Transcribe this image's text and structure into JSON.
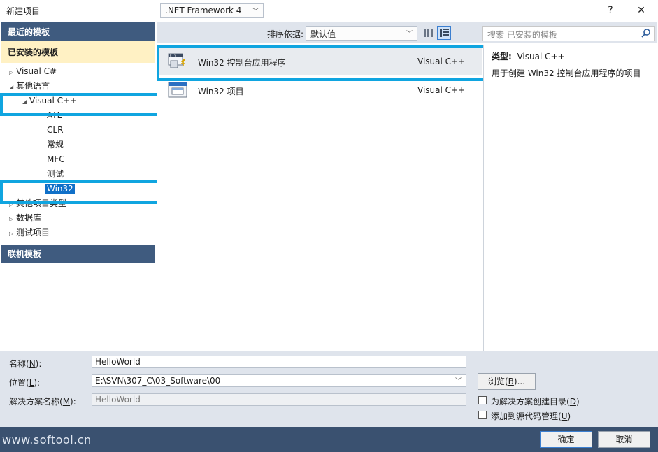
{
  "window": {
    "title": "新建项目",
    "help": "?",
    "close": "✕"
  },
  "left": {
    "recent_header": "最近的模板",
    "installed_header": "已安装的模板",
    "online_header": "联机模板",
    "tree": {
      "visual_csharp": "Visual C#",
      "other_languages": "其他语言",
      "visual_cpp": "Visual C++",
      "atl": "ATL",
      "clr": "CLR",
      "general": "常规",
      "mfc": "MFC",
      "test": "测试",
      "win32": "Win32",
      "other_project_types": "其他项目类型",
      "database": "数据库",
      "test_projects": "测试项目"
    }
  },
  "toolbar": {
    "framework": ".NET Framework 4",
    "sort_label": "排序依据:",
    "sort_value": "默认值",
    "search_placeholder": "搜索 已安装的模板"
  },
  "templates": [
    {
      "name": "Win32 控制台应用程序",
      "lang": "Visual C++",
      "icon": "console-app-icon"
    },
    {
      "name": "Win32 项目",
      "lang": "Visual C++",
      "icon": "window-project-icon"
    }
  ],
  "details": {
    "type_label": "类型:",
    "type_value": "Visual C++",
    "description": "用于创建 Win32 控制台应用程序的项目"
  },
  "form": {
    "name_label_pre": "名称(",
    "name_label_key": "N",
    "name_label_post": "):",
    "name_value": "HelloWorld",
    "location_label_pre": "位置(",
    "location_label_key": "L",
    "location_label_post": "):",
    "location_value": "E:\\SVN\\307_C\\03_Software\\00",
    "solution_label_pre": "解决方案名称(",
    "solution_label_key": "M",
    "solution_label_post": "):",
    "solution_value": "HelloWorld",
    "browse_pre": "浏览(",
    "browse_key": "B",
    "browse_post": ")...",
    "create_dir_pre": "为解决方案创建目录(",
    "create_dir_key": "D",
    "create_dir_post": ")",
    "source_control_pre": "添加到源代码管理(",
    "source_control_key": "U",
    "source_control_post": ")"
  },
  "buttons": {
    "ok": "确定",
    "cancel": "取消"
  },
  "watermark": "www.softool.cn",
  "colors": {
    "highlight_border": "#10a5e0",
    "header_bg": "#3f5b7f",
    "installed_bg": "#fff1c4",
    "footer_bg": "#3a5170"
  }
}
